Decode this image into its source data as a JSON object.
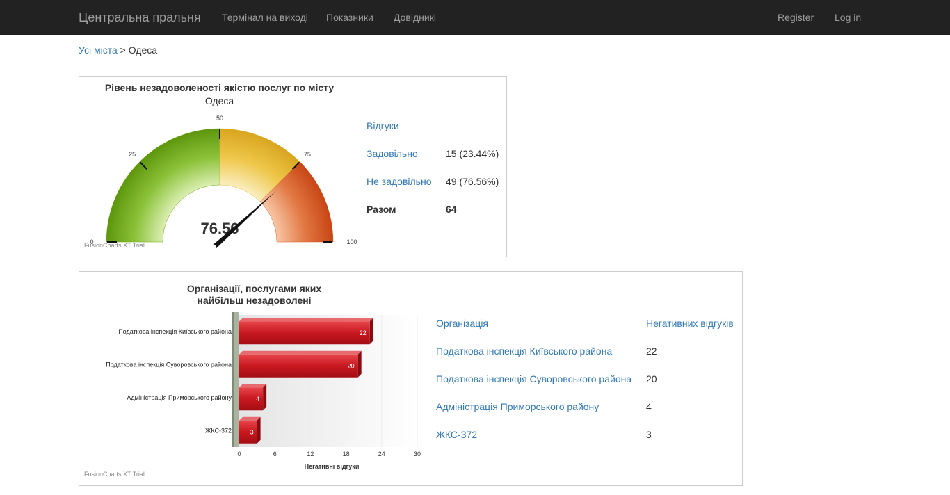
{
  "navbar": {
    "brand": "Центральна пральня",
    "links": [
      "Термінал на виході",
      "Показники",
      "Довідникі"
    ],
    "register": "Register",
    "login": "Log in"
  },
  "breadcrumb": {
    "root": "Усі міста",
    "separator": " > ",
    "current": "Одеса"
  },
  "gauge_panel": {
    "title": "Рівень незадоволеності якістю послуг по місту",
    "subtitle": "Одеса",
    "watermark": "FusionCharts XT Trial",
    "table": {
      "header": "Відгуки",
      "rows": [
        {
          "label": "Задовільно",
          "value": "15 (23.44%)"
        },
        {
          "label": "Не задовільно",
          "value": "49 (76.56%)"
        }
      ],
      "total_label": "Разом",
      "total_value": "64"
    }
  },
  "bar_panel": {
    "title_line1": "Організації, послугами яких",
    "title_line2": "найбільш незадоволені",
    "watermark": "FusionCharts XT Trial",
    "table": {
      "col1": "Організація",
      "col2": "Негативних відгуків",
      "rows": [
        {
          "org": "Податкова інспекція Київського района",
          "count": "22"
        },
        {
          "org": "Податкова інспекція Суворовського района",
          "count": "20"
        },
        {
          "org": "Адміністрація Приморського району",
          "count": "4"
        },
        {
          "org": "ЖКС-372",
          "count": "3"
        }
      ]
    }
  },
  "chart_data": [
    {
      "type": "gauge",
      "title": "Рівень незадоволеності якістю послуг по місту",
      "subtitle": "Одеса",
      "value": 76.56,
      "value_label": "76.56",
      "min": 0,
      "max": 100,
      "ticks": [
        0,
        25,
        50,
        75,
        100
      ],
      "bands": [
        {
          "from": 0,
          "to": 50,
          "color": "#6aa40f"
        },
        {
          "from": 50,
          "to": 75,
          "color": "#e8b830"
        },
        {
          "from": 75,
          "to": 100,
          "color": "#d9541e"
        }
      ]
    },
    {
      "type": "bar",
      "orientation": "horizontal",
      "title": "Організації, послугами яких найбільш незадоволені",
      "categories": [
        "Податкова інспекція Київського района",
        "Податкова інспекція Суворовського района",
        "Адміністрація Приморського району",
        "ЖКС-372"
      ],
      "values": [
        22,
        20,
        4,
        3
      ],
      "xlabel": "Негативні відгуки",
      "xlim": [
        0,
        30
      ],
      "xticks": [
        0,
        6,
        12,
        18,
        24,
        30
      ],
      "bar_color": "#c8171f"
    }
  ]
}
